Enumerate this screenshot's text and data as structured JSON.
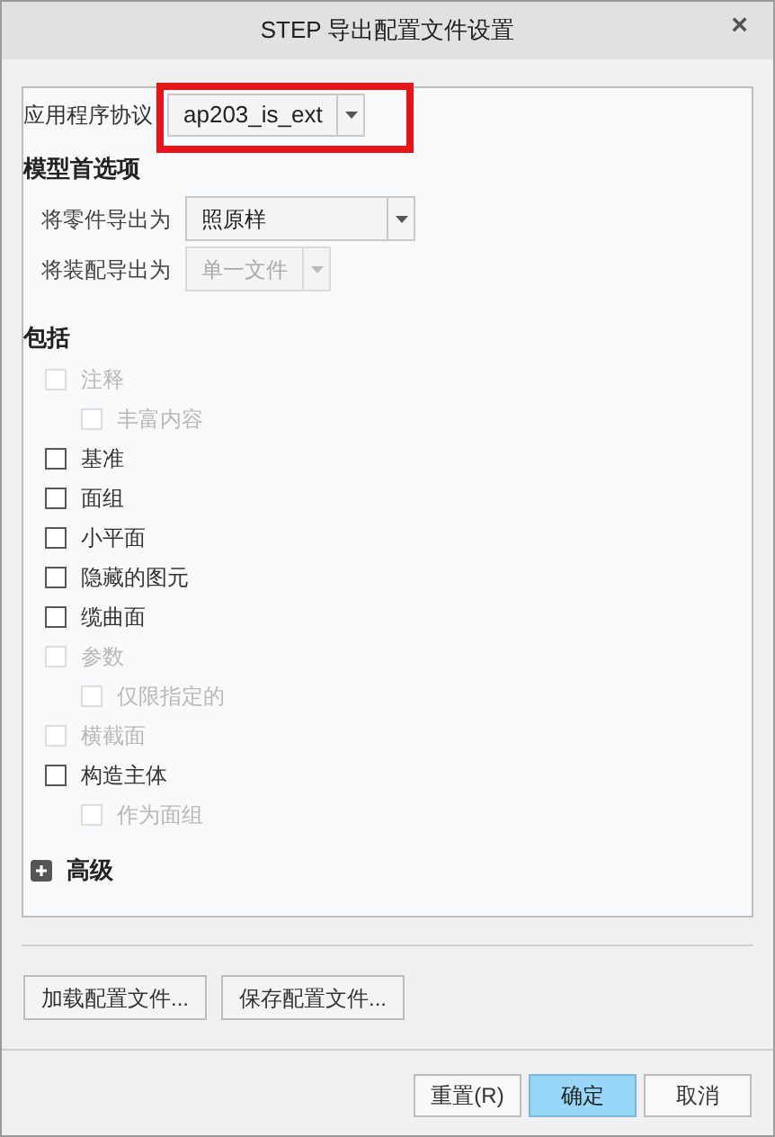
{
  "window": {
    "title": "STEP 导出配置文件设置",
    "close": "×"
  },
  "protocol": {
    "label": "应用程序协议",
    "value": "ap203_is_ext",
    "highlighted": true
  },
  "model_preferences": {
    "heading": "模型首选项",
    "fields": [
      {
        "label": "将零件导出为",
        "value": "照原样",
        "disabled": false
      },
      {
        "label": "将装配导出为",
        "value": "单一文件",
        "disabled": true
      }
    ]
  },
  "include": {
    "heading": "包括",
    "items": [
      {
        "label": "注释",
        "checked": false,
        "disabled": true,
        "children": [
          {
            "label": "丰富内容",
            "checked": false,
            "disabled": true
          }
        ]
      },
      {
        "label": "基准",
        "checked": false,
        "disabled": false
      },
      {
        "label": "面组",
        "checked": false,
        "disabled": false
      },
      {
        "label": "小平面",
        "checked": false,
        "disabled": false
      },
      {
        "label": "隐藏的图元",
        "checked": false,
        "disabled": false
      },
      {
        "label": "缆曲面",
        "checked": false,
        "disabled": false
      },
      {
        "label": "参数",
        "checked": false,
        "disabled": true,
        "children": [
          {
            "label": "仅限指定的",
            "checked": false,
            "disabled": true
          }
        ]
      },
      {
        "label": "横截面",
        "checked": false,
        "disabled": true
      },
      {
        "label": "构造主体",
        "checked": false,
        "disabled": false,
        "children": [
          {
            "label": "作为面组",
            "checked": false,
            "disabled": true
          }
        ]
      }
    ]
  },
  "advanced": {
    "label": "高级",
    "expanded": false
  },
  "profile_buttons": [
    "加载配置文件...",
    "保存配置文件..."
  ],
  "dialog_buttons": [
    {
      "label": "重置(R)",
      "default": false
    },
    {
      "label": "确定",
      "default": true
    },
    {
      "label": "取消",
      "default": false
    }
  ]
}
